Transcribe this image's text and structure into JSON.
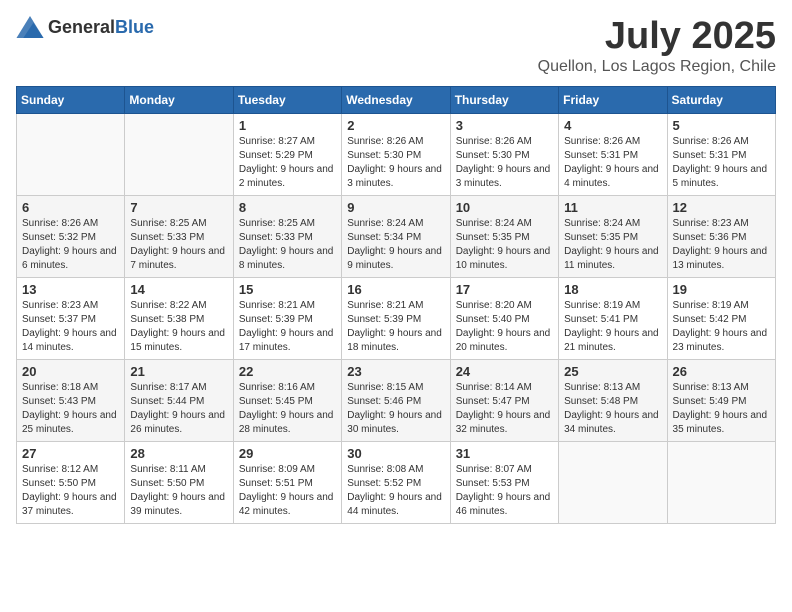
{
  "header": {
    "logo_general": "General",
    "logo_blue": "Blue",
    "month": "July 2025",
    "location": "Quellon, Los Lagos Region, Chile"
  },
  "calendar": {
    "days_of_week": [
      "Sunday",
      "Monday",
      "Tuesday",
      "Wednesday",
      "Thursday",
      "Friday",
      "Saturday"
    ],
    "weeks": [
      [
        {
          "day": "",
          "info": ""
        },
        {
          "day": "",
          "info": ""
        },
        {
          "day": "1",
          "info": "Sunrise: 8:27 AM\nSunset: 5:29 PM\nDaylight: 9 hours and 2 minutes."
        },
        {
          "day": "2",
          "info": "Sunrise: 8:26 AM\nSunset: 5:30 PM\nDaylight: 9 hours and 3 minutes."
        },
        {
          "day": "3",
          "info": "Sunrise: 8:26 AM\nSunset: 5:30 PM\nDaylight: 9 hours and 3 minutes."
        },
        {
          "day": "4",
          "info": "Sunrise: 8:26 AM\nSunset: 5:31 PM\nDaylight: 9 hours and 4 minutes."
        },
        {
          "day": "5",
          "info": "Sunrise: 8:26 AM\nSunset: 5:31 PM\nDaylight: 9 hours and 5 minutes."
        }
      ],
      [
        {
          "day": "6",
          "info": "Sunrise: 8:26 AM\nSunset: 5:32 PM\nDaylight: 9 hours and 6 minutes."
        },
        {
          "day": "7",
          "info": "Sunrise: 8:25 AM\nSunset: 5:33 PM\nDaylight: 9 hours and 7 minutes."
        },
        {
          "day": "8",
          "info": "Sunrise: 8:25 AM\nSunset: 5:33 PM\nDaylight: 9 hours and 8 minutes."
        },
        {
          "day": "9",
          "info": "Sunrise: 8:24 AM\nSunset: 5:34 PM\nDaylight: 9 hours and 9 minutes."
        },
        {
          "day": "10",
          "info": "Sunrise: 8:24 AM\nSunset: 5:35 PM\nDaylight: 9 hours and 10 minutes."
        },
        {
          "day": "11",
          "info": "Sunrise: 8:24 AM\nSunset: 5:35 PM\nDaylight: 9 hours and 11 minutes."
        },
        {
          "day": "12",
          "info": "Sunrise: 8:23 AM\nSunset: 5:36 PM\nDaylight: 9 hours and 13 minutes."
        }
      ],
      [
        {
          "day": "13",
          "info": "Sunrise: 8:23 AM\nSunset: 5:37 PM\nDaylight: 9 hours and 14 minutes."
        },
        {
          "day": "14",
          "info": "Sunrise: 8:22 AM\nSunset: 5:38 PM\nDaylight: 9 hours and 15 minutes."
        },
        {
          "day": "15",
          "info": "Sunrise: 8:21 AM\nSunset: 5:39 PM\nDaylight: 9 hours and 17 minutes."
        },
        {
          "day": "16",
          "info": "Sunrise: 8:21 AM\nSunset: 5:39 PM\nDaylight: 9 hours and 18 minutes."
        },
        {
          "day": "17",
          "info": "Sunrise: 8:20 AM\nSunset: 5:40 PM\nDaylight: 9 hours and 20 minutes."
        },
        {
          "day": "18",
          "info": "Sunrise: 8:19 AM\nSunset: 5:41 PM\nDaylight: 9 hours and 21 minutes."
        },
        {
          "day": "19",
          "info": "Sunrise: 8:19 AM\nSunset: 5:42 PM\nDaylight: 9 hours and 23 minutes."
        }
      ],
      [
        {
          "day": "20",
          "info": "Sunrise: 8:18 AM\nSunset: 5:43 PM\nDaylight: 9 hours and 25 minutes."
        },
        {
          "day": "21",
          "info": "Sunrise: 8:17 AM\nSunset: 5:44 PM\nDaylight: 9 hours and 26 minutes."
        },
        {
          "day": "22",
          "info": "Sunrise: 8:16 AM\nSunset: 5:45 PM\nDaylight: 9 hours and 28 minutes."
        },
        {
          "day": "23",
          "info": "Sunrise: 8:15 AM\nSunset: 5:46 PM\nDaylight: 9 hours and 30 minutes."
        },
        {
          "day": "24",
          "info": "Sunrise: 8:14 AM\nSunset: 5:47 PM\nDaylight: 9 hours and 32 minutes."
        },
        {
          "day": "25",
          "info": "Sunrise: 8:13 AM\nSunset: 5:48 PM\nDaylight: 9 hours and 34 minutes."
        },
        {
          "day": "26",
          "info": "Sunrise: 8:13 AM\nSunset: 5:49 PM\nDaylight: 9 hours and 35 minutes."
        }
      ],
      [
        {
          "day": "27",
          "info": "Sunrise: 8:12 AM\nSunset: 5:50 PM\nDaylight: 9 hours and 37 minutes."
        },
        {
          "day": "28",
          "info": "Sunrise: 8:11 AM\nSunset: 5:50 PM\nDaylight: 9 hours and 39 minutes."
        },
        {
          "day": "29",
          "info": "Sunrise: 8:09 AM\nSunset: 5:51 PM\nDaylight: 9 hours and 42 minutes."
        },
        {
          "day": "30",
          "info": "Sunrise: 8:08 AM\nSunset: 5:52 PM\nDaylight: 9 hours and 44 minutes."
        },
        {
          "day": "31",
          "info": "Sunrise: 8:07 AM\nSunset: 5:53 PM\nDaylight: 9 hours and 46 minutes."
        },
        {
          "day": "",
          "info": ""
        },
        {
          "day": "",
          "info": ""
        }
      ]
    ]
  }
}
